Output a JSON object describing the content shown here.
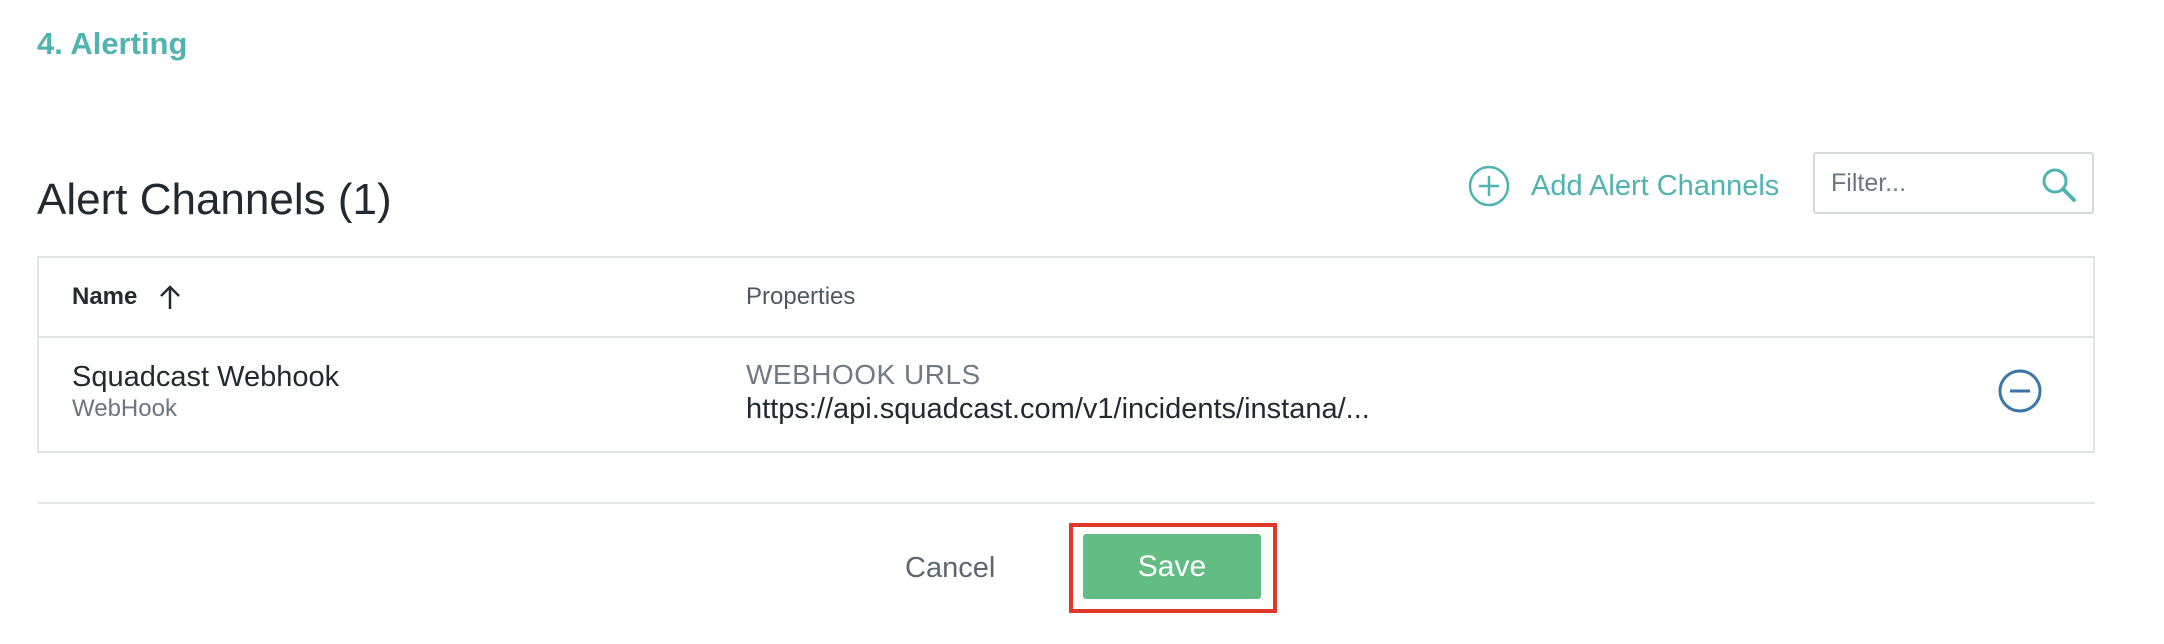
{
  "section": {
    "title": "4. Alerting"
  },
  "alert_channels": {
    "title": "Alert Channels (1)",
    "add_label": "Add Alert Channels",
    "filter_placeholder": "Filter..."
  },
  "table": {
    "columns": {
      "name": "Name",
      "properties": "Properties"
    },
    "sort": {
      "column": "Name",
      "direction": "ascending"
    },
    "rows": [
      {
        "name": "Squadcast Webhook",
        "type": "WebHook",
        "property_label": "WEBHOOK URLS",
        "property_value": "https://api.squadcast.com/v1/incidents/instana/..."
      }
    ]
  },
  "actions": {
    "cancel_label": "Cancel",
    "save_label": "Save"
  },
  "colors": {
    "accent": "#4fb3b0",
    "save": "#62bd83",
    "highlight": "#e0392b",
    "remove_icon": "#3b76a8"
  },
  "icons": {
    "add": "plus-circle-icon",
    "search": "search-icon",
    "sort": "arrow-up-icon",
    "remove": "minus-circle-icon"
  }
}
